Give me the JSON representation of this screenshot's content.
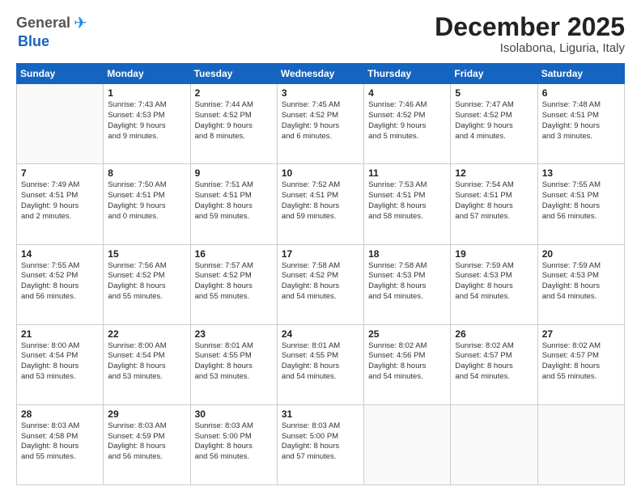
{
  "header": {
    "logo_general": "General",
    "logo_blue": "Blue",
    "month": "December 2025",
    "location": "Isolabona, Liguria, Italy"
  },
  "weekdays": [
    "Sunday",
    "Monday",
    "Tuesday",
    "Wednesday",
    "Thursday",
    "Friday",
    "Saturday"
  ],
  "weeks": [
    [
      {
        "day": "",
        "info": ""
      },
      {
        "day": "1",
        "info": "Sunrise: 7:43 AM\nSunset: 4:53 PM\nDaylight: 9 hours\nand 9 minutes."
      },
      {
        "day": "2",
        "info": "Sunrise: 7:44 AM\nSunset: 4:52 PM\nDaylight: 9 hours\nand 8 minutes."
      },
      {
        "day": "3",
        "info": "Sunrise: 7:45 AM\nSunset: 4:52 PM\nDaylight: 9 hours\nand 6 minutes."
      },
      {
        "day": "4",
        "info": "Sunrise: 7:46 AM\nSunset: 4:52 PM\nDaylight: 9 hours\nand 5 minutes."
      },
      {
        "day": "5",
        "info": "Sunrise: 7:47 AM\nSunset: 4:52 PM\nDaylight: 9 hours\nand 4 minutes."
      },
      {
        "day": "6",
        "info": "Sunrise: 7:48 AM\nSunset: 4:51 PM\nDaylight: 9 hours\nand 3 minutes."
      }
    ],
    [
      {
        "day": "7",
        "info": "Sunrise: 7:49 AM\nSunset: 4:51 PM\nDaylight: 9 hours\nand 2 minutes."
      },
      {
        "day": "8",
        "info": "Sunrise: 7:50 AM\nSunset: 4:51 PM\nDaylight: 9 hours\nand 0 minutes."
      },
      {
        "day": "9",
        "info": "Sunrise: 7:51 AM\nSunset: 4:51 PM\nDaylight: 8 hours\nand 59 minutes."
      },
      {
        "day": "10",
        "info": "Sunrise: 7:52 AM\nSunset: 4:51 PM\nDaylight: 8 hours\nand 59 minutes."
      },
      {
        "day": "11",
        "info": "Sunrise: 7:53 AM\nSunset: 4:51 PM\nDaylight: 8 hours\nand 58 minutes."
      },
      {
        "day": "12",
        "info": "Sunrise: 7:54 AM\nSunset: 4:51 PM\nDaylight: 8 hours\nand 57 minutes."
      },
      {
        "day": "13",
        "info": "Sunrise: 7:55 AM\nSunset: 4:51 PM\nDaylight: 8 hours\nand 56 minutes."
      }
    ],
    [
      {
        "day": "14",
        "info": "Sunrise: 7:55 AM\nSunset: 4:52 PM\nDaylight: 8 hours\nand 56 minutes."
      },
      {
        "day": "15",
        "info": "Sunrise: 7:56 AM\nSunset: 4:52 PM\nDaylight: 8 hours\nand 55 minutes."
      },
      {
        "day": "16",
        "info": "Sunrise: 7:57 AM\nSunset: 4:52 PM\nDaylight: 8 hours\nand 55 minutes."
      },
      {
        "day": "17",
        "info": "Sunrise: 7:58 AM\nSunset: 4:52 PM\nDaylight: 8 hours\nand 54 minutes."
      },
      {
        "day": "18",
        "info": "Sunrise: 7:58 AM\nSunset: 4:53 PM\nDaylight: 8 hours\nand 54 minutes."
      },
      {
        "day": "19",
        "info": "Sunrise: 7:59 AM\nSunset: 4:53 PM\nDaylight: 8 hours\nand 54 minutes."
      },
      {
        "day": "20",
        "info": "Sunrise: 7:59 AM\nSunset: 4:53 PM\nDaylight: 8 hours\nand 54 minutes."
      }
    ],
    [
      {
        "day": "21",
        "info": "Sunrise: 8:00 AM\nSunset: 4:54 PM\nDaylight: 8 hours\nand 53 minutes."
      },
      {
        "day": "22",
        "info": "Sunrise: 8:00 AM\nSunset: 4:54 PM\nDaylight: 8 hours\nand 53 minutes."
      },
      {
        "day": "23",
        "info": "Sunrise: 8:01 AM\nSunset: 4:55 PM\nDaylight: 8 hours\nand 53 minutes."
      },
      {
        "day": "24",
        "info": "Sunrise: 8:01 AM\nSunset: 4:55 PM\nDaylight: 8 hours\nand 54 minutes."
      },
      {
        "day": "25",
        "info": "Sunrise: 8:02 AM\nSunset: 4:56 PM\nDaylight: 8 hours\nand 54 minutes."
      },
      {
        "day": "26",
        "info": "Sunrise: 8:02 AM\nSunset: 4:57 PM\nDaylight: 8 hours\nand 54 minutes."
      },
      {
        "day": "27",
        "info": "Sunrise: 8:02 AM\nSunset: 4:57 PM\nDaylight: 8 hours\nand 55 minutes."
      }
    ],
    [
      {
        "day": "28",
        "info": "Sunrise: 8:03 AM\nSunset: 4:58 PM\nDaylight: 8 hours\nand 55 minutes."
      },
      {
        "day": "29",
        "info": "Sunrise: 8:03 AM\nSunset: 4:59 PM\nDaylight: 8 hours\nand 56 minutes."
      },
      {
        "day": "30",
        "info": "Sunrise: 8:03 AM\nSunset: 5:00 PM\nDaylight: 8 hours\nand 56 minutes."
      },
      {
        "day": "31",
        "info": "Sunrise: 8:03 AM\nSunset: 5:00 PM\nDaylight: 8 hours\nand 57 minutes."
      },
      {
        "day": "",
        "info": ""
      },
      {
        "day": "",
        "info": ""
      },
      {
        "day": "",
        "info": ""
      }
    ]
  ]
}
